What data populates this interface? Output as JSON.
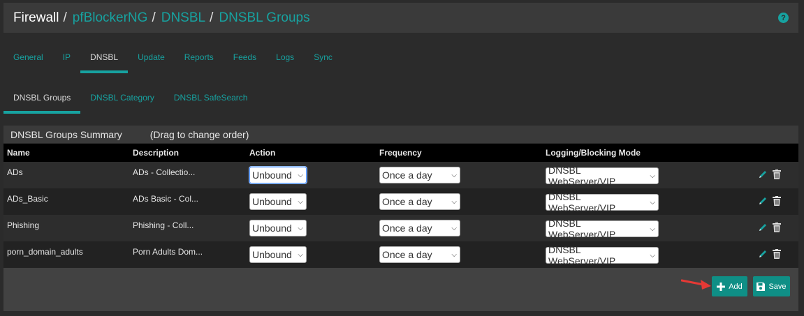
{
  "breadcrumb": {
    "items": [
      "Firewall",
      "pfBlockerNG",
      "DNSBL",
      "DNSBL Groups"
    ],
    "separator": "/"
  },
  "help_icon": "question-icon",
  "main_tabs": [
    {
      "label": "General"
    },
    {
      "label": "IP"
    },
    {
      "label": "DNSBL",
      "active": true
    },
    {
      "label": "Update"
    },
    {
      "label": "Reports"
    },
    {
      "label": "Feeds"
    },
    {
      "label": "Logs"
    },
    {
      "label": "Sync"
    }
  ],
  "sub_tabs": [
    {
      "label": "DNSBL Groups",
      "active": true
    },
    {
      "label": "DNSBL Category"
    },
    {
      "label": "DNSBL SafeSearch"
    }
  ],
  "panel": {
    "title": "DNSBL Groups Summary",
    "hint": "(Drag to change order)"
  },
  "table": {
    "columns": [
      "Name",
      "Description",
      "Action",
      "Frequency",
      "Logging/Blocking Mode"
    ],
    "rows": [
      {
        "name": "ADs",
        "description": "ADs - Collectio...",
        "action": "Unbound",
        "frequency": "Once a day",
        "mode": "DNSBL WebServer/VIP"
      },
      {
        "name": "ADs_Basic",
        "description": "ADs Basic - Col...",
        "action": "Unbound",
        "frequency": "Once a day",
        "mode": "DNSBL WebServer/VIP"
      },
      {
        "name": "Phishing",
        "description": "Phishing - Coll...",
        "action": "Unbound",
        "frequency": "Once a day",
        "mode": "DNSBL WebServer/VIP"
      },
      {
        "name": "porn_domain_adults",
        "description": "Porn Adults Dom...",
        "action": "Unbound",
        "frequency": "Once a day",
        "mode": "DNSBL WebServer/VIP"
      }
    ]
  },
  "buttons": {
    "add": "Add",
    "save": "Save"
  },
  "colors": {
    "accent": "#17a2a0",
    "button": "#0f8f86",
    "annotation_arrow": "#e53935"
  }
}
